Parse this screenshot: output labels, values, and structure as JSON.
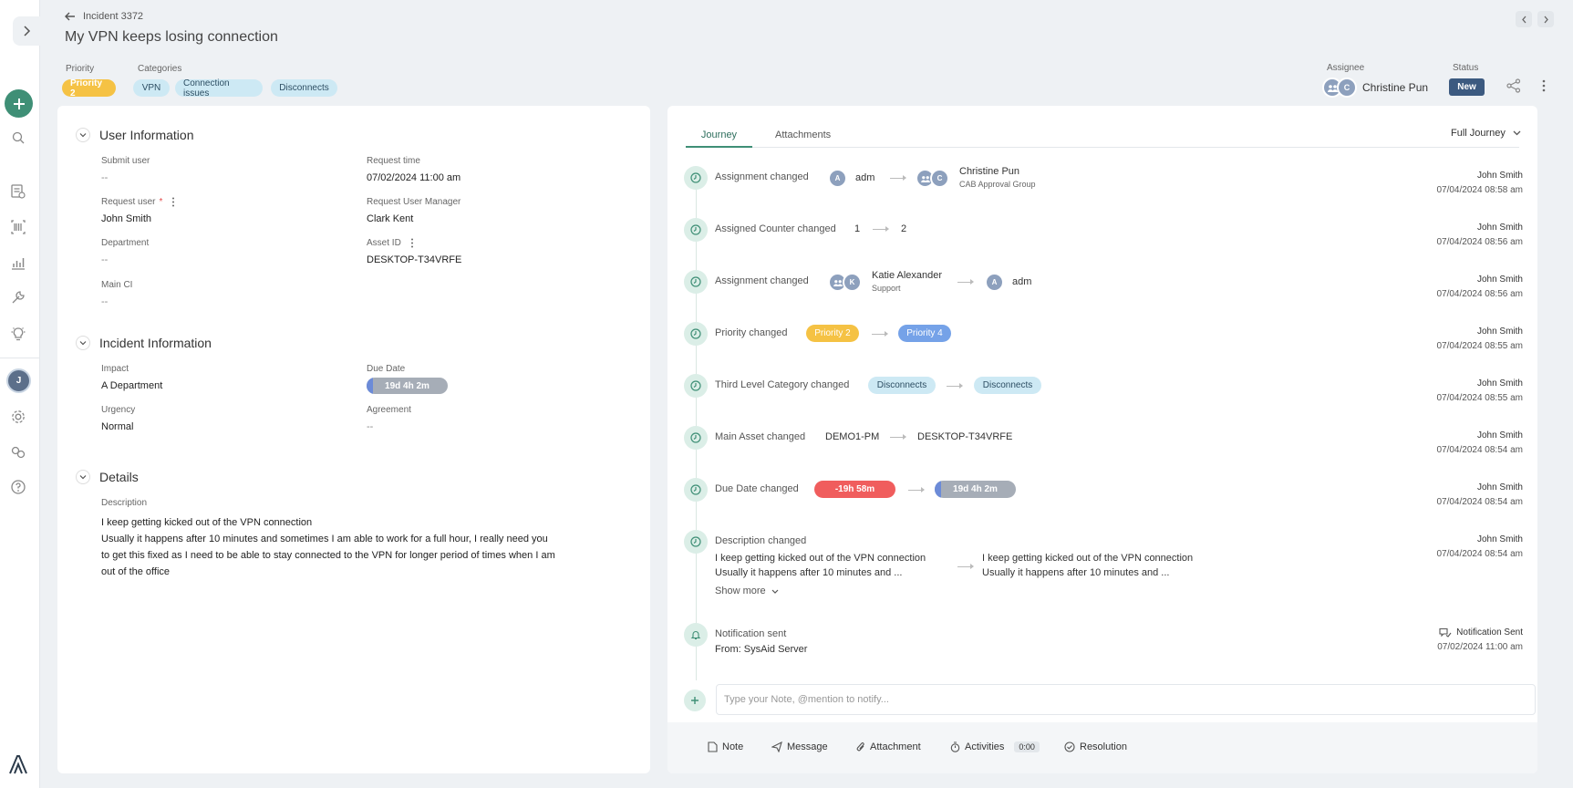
{
  "header": {
    "breadcrumb": "Incident 3372",
    "title": "My VPN keeps losing connection",
    "priority_label": "Priority",
    "priority_value": "Priority 2",
    "categories_label": "Categories",
    "categories": [
      "VPN",
      "Connection issues",
      "Disconnects"
    ],
    "assignee_label": "Assignee",
    "assignee_name": "Christine Pun",
    "assignee_initial": "C",
    "status_label": "Status",
    "status_value": "New"
  },
  "rail": {
    "user_initial": "J"
  },
  "user_info": {
    "title": "User Information",
    "submit_user_label": "Submit user",
    "submit_user_value": "--",
    "request_time_label": "Request time",
    "request_time_value": "07/02/2024 11:00 am",
    "request_user_label": "Request user",
    "required_mark": "*",
    "request_user_value": "John Smith",
    "manager_label": "Request User Manager",
    "manager_value": "Clark Kent",
    "department_label": "Department",
    "department_value": "--",
    "asset_label": "Asset ID",
    "asset_value": "DESKTOP-T34VRFE",
    "main_ci_label": "Main CI",
    "main_ci_value": "--"
  },
  "incident_info": {
    "title": "Incident Information",
    "impact_label": "Impact",
    "impact_value": "A Department",
    "due_label": "Due Date",
    "due_value": "19d 4h 2m",
    "urgency_label": "Urgency",
    "urgency_value": "Normal",
    "agreement_label": "Agreement",
    "agreement_value": "--"
  },
  "details": {
    "title": "Details",
    "desc_label": "Description",
    "desc_lines": [
      "I keep getting kicked out of the VPN connection",
      "Usually it happens after 10 minutes and sometimes I am able to work for a full hour, I really need you",
      "to get this fixed as I need to be able to stay connected to the VPN for longer period of times when I am",
      "out of the office"
    ]
  },
  "journey": {
    "tabs": [
      "Journey",
      "Attachments"
    ],
    "filter": "Full Journey",
    "entries": [
      {
        "title": "Assignment changed",
        "from": "adm",
        "from_initial": "A",
        "to": "Christine Pun",
        "to_initial": "C",
        "to_sub": "CAB Approval Group",
        "user": "John Smith",
        "time": "07/04/2024 08:58 am"
      },
      {
        "title": "Assigned Counter changed",
        "from": "1",
        "to": "2",
        "user": "John Smith",
        "time": "07/04/2024 08:56 am"
      },
      {
        "title": "Assignment changed",
        "from": "Katie Alexander",
        "from_initial": "K",
        "from_sub": "Support",
        "to": "adm",
        "to_initial": "A",
        "user": "John Smith",
        "time": "07/04/2024 08:56 am"
      },
      {
        "title": "Priority changed",
        "from": "Priority 2",
        "to": "Priority 4",
        "user": "John Smith",
        "time": "07/04/2024 08:55 am"
      },
      {
        "title": "Third Level Category changed",
        "from": "Disconnects",
        "to": "Disconnects",
        "user": "John Smith",
        "time": "07/04/2024 08:55 am"
      },
      {
        "title": "Main Asset changed",
        "from": "DEMO1-PM",
        "to": "DESKTOP-T34VRFE",
        "user": "John Smith",
        "time": "07/04/2024 08:54 am"
      },
      {
        "title": "Due Date changed",
        "from": "-19h 58m",
        "to": "19d 4h 2m",
        "user": "John Smith",
        "time": "07/04/2024 08:54 am"
      },
      {
        "title": "Description changed",
        "from_l1": "I keep getting kicked out of the VPN connection",
        "from_l2": "Usually it happens after 10 minutes and ...",
        "to_l1": "I keep getting kicked out of the VPN connection",
        "to_l2": "Usually it happens after 10 minutes and ...",
        "show_more": "Show more",
        "user": "John Smith",
        "time": "07/04/2024 08:54 am"
      },
      {
        "title": "Notification sent",
        "from_text": "From: SysAid Server",
        "user": "Notification Sent",
        "time": "07/02/2024 11:00 am"
      }
    ],
    "note_placeholder": "Type your Note, @mention to notify..."
  },
  "actions": {
    "note": "Note",
    "message": "Message",
    "attachment": "Attachment",
    "activities": "Activities",
    "timer": "0:00",
    "resolution": "Resolution"
  },
  "colors": {
    "accent": "#3f8f76",
    "priority2": "#f5c244",
    "priority4": "#75a2e8",
    "category": "#cde9f4",
    "overdue": "#f05d5d",
    "status": "#3c5a80"
  }
}
